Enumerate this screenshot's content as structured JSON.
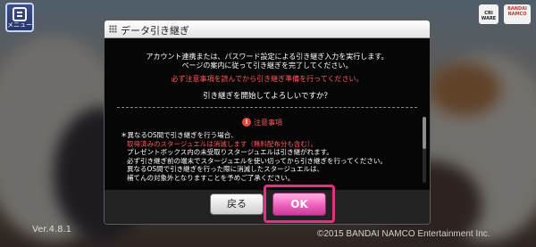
{
  "hud": {
    "menu_label": "メニュー",
    "logo_left": "CRI WARE",
    "logo_right": "BANDAI NAMCO",
    "version": "Ver.4.8.1",
    "copyright": "©2015 BANDAI NAMCO Entertainment Inc."
  },
  "dialog": {
    "title": "データ引き継ぎ",
    "intro_lines": [
      "アカウント連携または、パスワード設定による引き継ぎ入力を実行します。",
      "ページの案内に従って引き継ぎを完了してください。"
    ],
    "warning_line": "必ず注意事項を読んでから引き継ぎ準備を行ってください。",
    "question": "引き継ぎを開始してよろしいですか？",
    "notice_title": "注意事項",
    "notes": [
      {
        "text": "＊異なるOS間で引き継ぎを行う場合、",
        "style": "normal"
      },
      {
        "text": "取得済みのスタージュエルは消滅します（無料配布分も含む）。",
        "style": "red"
      },
      {
        "text": "プレゼントボックス内の未受取りスタージュエルは引き継がれます。",
        "style": "normal"
      },
      {
        "text": "必ず引き継ぎ前の端末でスタージュエルを使い切ってから引き継ぎを行ってください。",
        "style": "normal"
      },
      {
        "text": "異なるOS間で引き継ぎを行った際に消滅したスタージュエルは、",
        "style": "normal"
      },
      {
        "text": "補てんの対象外となりますことを予めご了承ください。",
        "style": "normal"
      }
    ],
    "buttons": {
      "back": "戻る",
      "ok": "OK"
    }
  },
  "colors": {
    "warning_red": "#ff5a5a",
    "highlight_frame": "#e8317e",
    "ok_pink": "#ee61be"
  }
}
